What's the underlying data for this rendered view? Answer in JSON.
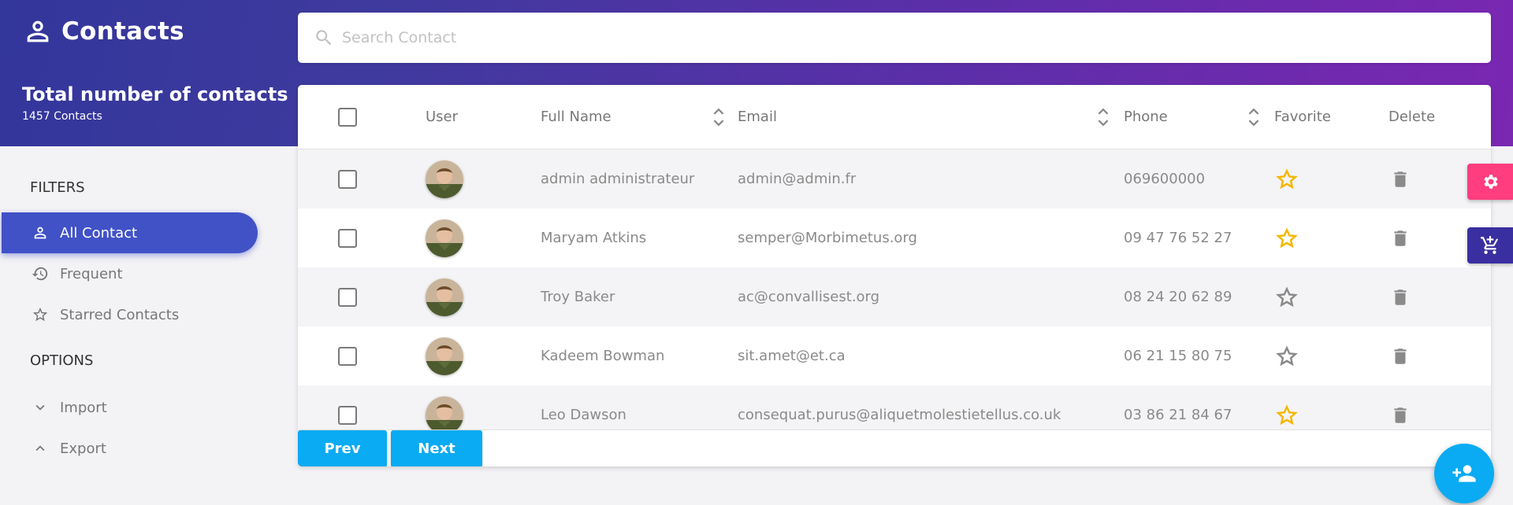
{
  "app": {
    "title": "Contacts"
  },
  "summary": {
    "title": "Total number of contacts",
    "count": "1457 Contacts"
  },
  "search": {
    "placeholder": "Search Contact",
    "value": ""
  },
  "sidebar": {
    "filters_label": "FILTERS",
    "filters": [
      {
        "label": "All Contact",
        "icon": "person-icon",
        "active": true
      },
      {
        "label": "Frequent",
        "icon": "history-icon",
        "active": false
      },
      {
        "label": "Starred Contacts",
        "icon": "star-outline-icon",
        "active": false
      }
    ],
    "options_label": "OPTIONS",
    "options": [
      {
        "label": "Import",
        "icon": "chevron-down-icon"
      },
      {
        "label": "Export",
        "icon": "chevron-up-icon"
      }
    ]
  },
  "table": {
    "columns": [
      "User",
      "Full Name",
      "Email",
      "Phone",
      "Favorite",
      "Delete"
    ],
    "rows": [
      {
        "name": "admin administrateur",
        "email": "admin@admin.fr",
        "phone": "069600000",
        "favorite": true,
        "checked": false
      },
      {
        "name": "Maryam Atkins",
        "email": "semper@Morbimetus.org",
        "phone": "09 47 76 52 27",
        "favorite": true,
        "checked": false
      },
      {
        "name": "Troy Baker",
        "email": "ac@convallisest.org",
        "phone": "08 24 20 62 89",
        "favorite": false,
        "checked": false
      },
      {
        "name": "Kadeem Bowman",
        "email": "sit.amet@et.ca",
        "phone": "06 21 15 80 75",
        "favorite": false,
        "checked": false
      },
      {
        "name": "Leo Dawson",
        "email": "consequat.purus@aliquetmolestietellus.co.uk",
        "phone": "03 86 21 84 67",
        "favorite": true,
        "checked": false
      }
    ]
  },
  "pagination": {
    "prev": "Prev",
    "next": "Next"
  },
  "colors": {
    "accent": "#4152c7",
    "button": "#0aabf2",
    "star": "#f5b700",
    "settings_tab": "#ff3d7f",
    "cart_tab": "#3a2fa0"
  },
  "icons": {
    "settings_tab": "gear-icon",
    "cart_tab": "add-shopping-cart-icon",
    "fab": "person-add-icon",
    "delete": "trash-icon",
    "search": "search-icon",
    "brand": "person-icon"
  }
}
